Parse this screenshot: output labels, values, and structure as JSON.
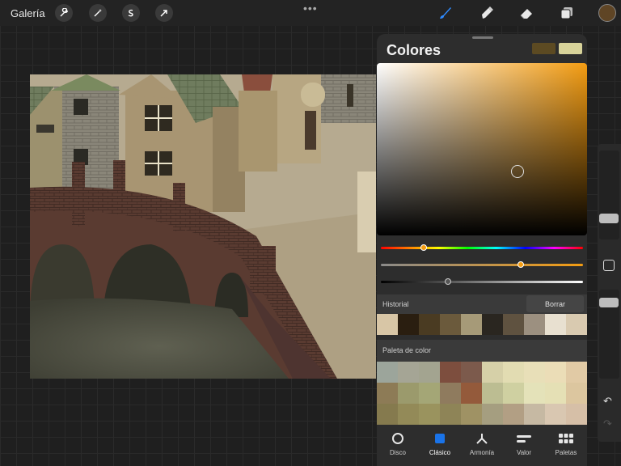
{
  "topbar": {
    "gallery_label": "Galería",
    "left_tools": [
      "wrench-icon",
      "magic-wand-icon",
      "selection-icon",
      "arrow-icon"
    ],
    "more_label": "•••",
    "right_tools": [
      "brush-icon",
      "smudge-icon",
      "eraser-icon",
      "layers-icon"
    ],
    "active_tool": "brush-icon",
    "active_color": "#5f4525"
  },
  "colors_panel": {
    "title": "Colores",
    "current_color": "#5c4a22",
    "previous_color": "#d8d39a",
    "picker_hue_color": "#f39c12",
    "sliders": {
      "hue": {
        "gradient": "rainbow",
        "position": 0.21
      },
      "saturation": {
        "gradient": "grey-to-orange",
        "position": 0.69
      },
      "brightness": {
        "gradient": "black-to-white",
        "position": 0.33
      }
    },
    "picker_cursor": {
      "saturation": 0.67,
      "brightness": 0.37
    },
    "history": {
      "label": "Historial",
      "clear_label": "Borrar",
      "swatches": [
        "#d8c6a6",
        "#2a1e10",
        "#4a3b22",
        "#6b5a3c",
        "#a69a78",
        "#2a2620",
        "#5f5240",
        "#9c9080",
        "#e8e0d0",
        "#d9cab0"
      ]
    },
    "palette": {
      "label": "Paleta de color",
      "swatches": [
        "#9ca59b",
        "#a5a595",
        "#a3a490",
        "#7d4e3e",
        "#7c5a4c",
        "#d6d0a8",
        "#e2dcb2",
        "#e8dfb8",
        "#ebddb7",
        "#e1caa5",
        "#8d7b56",
        "#9b9a6c",
        "#a4a676",
        "#8f7b5e",
        "#945a3b",
        "#bcbd92",
        "#cfd0a1",
        "#e4e2b9",
        "#e5e0b5",
        "#dcc69f",
        "#857a4e",
        "#938a58",
        "#9a935e",
        "#8e8457",
        "#9f9264",
        "#a59e80",
        "#b29f84",
        "#c6b9a3",
        "#d9c7b1",
        "#d6bfa7"
      ]
    },
    "tabs": [
      {
        "label": "Disco",
        "icon": "disc-icon",
        "active": false
      },
      {
        "label": "Clásico",
        "icon": "classic-square-icon",
        "active": true
      },
      {
        "label": "Armonía",
        "icon": "harmony-icon",
        "active": false
      },
      {
        "label": "Valor",
        "icon": "value-icon",
        "active": false
      },
      {
        "label": "Paletas",
        "icon": "palettes-icon",
        "active": false
      }
    ],
    "active_tab_color": "#1a73e8"
  },
  "sidebar": {
    "brush_size": 0.2,
    "opacity": 0.9
  }
}
